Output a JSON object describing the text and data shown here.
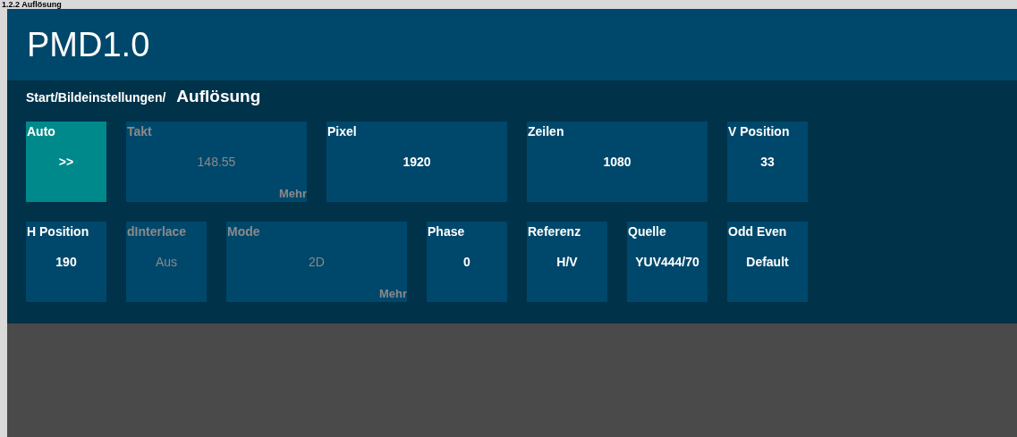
{
  "caption": "1.2.2 Auflösung",
  "app": {
    "title": "PMD1.0"
  },
  "breadcrumb": {
    "path": "Start/Bildeinstellungen/",
    "current": "Auflösung"
  },
  "tiles": [
    {
      "label": "Auto",
      "value": ">>",
      "wide": false,
      "disabled": false,
      "selected": true
    },
    {
      "label": "Takt",
      "value": "148.55",
      "more": "Mehr",
      "wide": true,
      "disabled": true,
      "selected": false
    },
    {
      "label": "Pixel",
      "value": "1920",
      "wide": true,
      "disabled": false,
      "selected": false
    },
    {
      "label": "Zeilen",
      "value": "1080",
      "wide": true,
      "disabled": false,
      "selected": false
    },
    {
      "label": "V Position",
      "value": "33",
      "wide": false,
      "disabled": false,
      "selected": false
    },
    {
      "label": "H Position",
      "value": "190",
      "wide": false,
      "disabled": false,
      "selected": false
    },
    {
      "label": "dInterlace",
      "value": "Aus",
      "wide": false,
      "disabled": true,
      "selected": false
    },
    {
      "label": "Mode",
      "value": "2D",
      "more": "Mehr",
      "wide": true,
      "disabled": true,
      "selected": false
    },
    {
      "label": "Phase",
      "value": "0",
      "wide": false,
      "disabled": false,
      "selected": false
    },
    {
      "label": "Referenz",
      "value": "H/V",
      "wide": false,
      "disabled": false,
      "selected": false
    },
    {
      "label": "Quelle",
      "value": "YUV444/70",
      "wide": false,
      "disabled": false,
      "selected": false
    },
    {
      "label": "Odd Even",
      "value": "Default",
      "wide": false,
      "disabled": false,
      "selected": false
    }
  ]
}
